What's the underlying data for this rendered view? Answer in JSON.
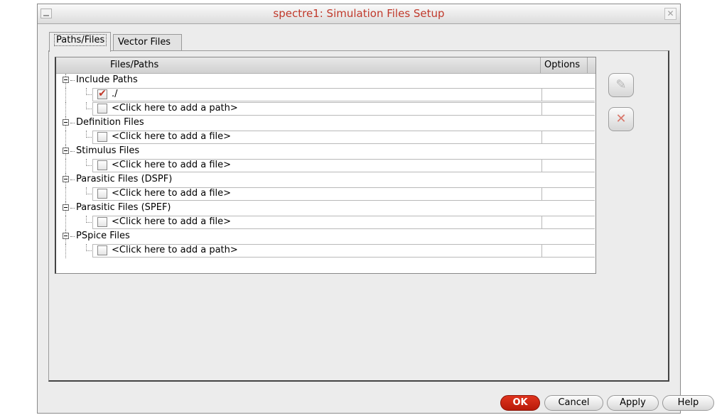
{
  "window": {
    "title": "spectre1: Simulation Files Setup",
    "close_glyph": "✕"
  },
  "tabs": [
    {
      "label": "Paths/Files",
      "active": true
    },
    {
      "label": "Vector Files",
      "active": false
    }
  ],
  "table": {
    "columns": [
      "Files/Paths",
      "Options"
    ],
    "groups": [
      {
        "label": "Include Paths",
        "children": [
          {
            "label": "./",
            "checked": true
          },
          {
            "label": "<Click here to add a path>",
            "checked": false
          }
        ]
      },
      {
        "label": "Definition Files",
        "children": [
          {
            "label": "<Click here to add a file>",
            "checked": false
          }
        ]
      },
      {
        "label": "Stimulus Files",
        "children": [
          {
            "label": "<Click here to add a file>",
            "checked": false
          }
        ]
      },
      {
        "label": "Parasitic Files (DSPF)",
        "children": [
          {
            "label": "<Click here to add a file>",
            "checked": false
          }
        ]
      },
      {
        "label": "Parasitic Files (SPEF)",
        "children": [
          {
            "label": "<Click here to add a file>",
            "checked": false
          }
        ]
      },
      {
        "label": "PSpice Files",
        "children": [
          {
            "label": "<Click here to add a path>",
            "checked": false
          }
        ]
      }
    ]
  },
  "side_buttons": {
    "edit_icon": "✎",
    "delete_icon": "✕"
  },
  "buttons": {
    "ok": "OK",
    "cancel": "Cancel",
    "apply": "Apply",
    "help": "Help"
  },
  "colors": {
    "title": "#c0392b",
    "ok_button": "#c8250f",
    "check": "#c0392b"
  }
}
